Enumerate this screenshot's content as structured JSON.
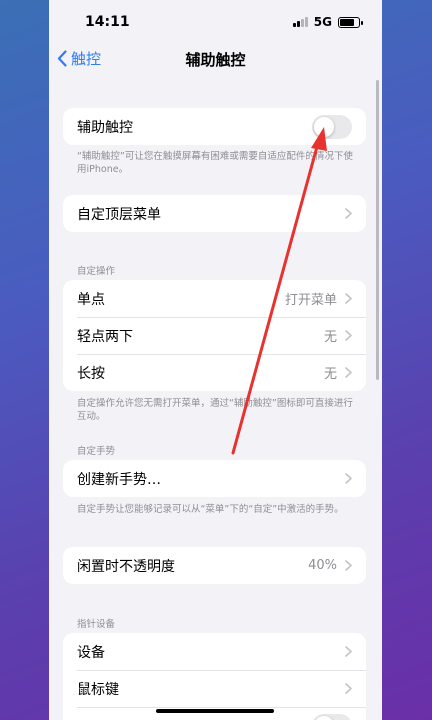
{
  "status": {
    "time": "14:11",
    "network": "5G"
  },
  "nav": {
    "back_label": "触控",
    "title": "辅助触控"
  },
  "assistive": {
    "label": "辅助触控",
    "toggle_on": false,
    "description": "“辅助触控”可让您在触摸屏幕有困难或需要自适应配件的情况下使用iPhone。"
  },
  "top_menu": {
    "label": "自定顶层菜单"
  },
  "custom_actions": {
    "header": "自定操作",
    "items": [
      {
        "label": "单点",
        "value": "打开菜单"
      },
      {
        "label": "轻点两下",
        "value": "无"
      },
      {
        "label": "长按",
        "value": "无"
      }
    ],
    "footnote": "自定操作允许您无需打开菜单，通过“辅助触控”图标即可直接进行互动。"
  },
  "custom_gestures": {
    "header": "自定手势",
    "create_label": "创建新手势…",
    "footnote": "自定手势让您能够记录可以从“菜单”下的“自定”中激活的手势。"
  },
  "idle_opacity": {
    "label": "闲置时不透明度",
    "value": "40%"
  },
  "pointer_devices": {
    "header": "指针设备",
    "items": [
      {
        "label": "设备"
      },
      {
        "label": "鼠标键"
      }
    ]
  },
  "colors": {
    "accent": "#2f7cf6",
    "annotation_arrow": "#e8322f"
  }
}
